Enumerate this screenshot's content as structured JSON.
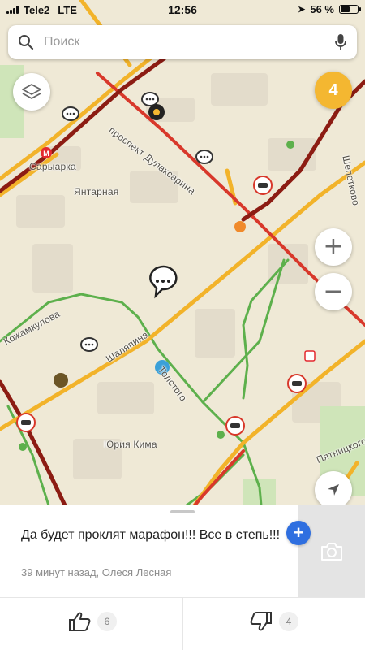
{
  "status_bar": {
    "carrier": "Tele2",
    "network": "LTE",
    "time": "12:56",
    "battery_text": "56 %",
    "battery_level": 0.56
  },
  "search": {
    "placeholder": "Поиск",
    "icon": "search-icon",
    "mic_icon": "microphone-icon"
  },
  "map": {
    "traffic_level": "4",
    "traffic_color": "#f4b731",
    "streets": {
      "prospekt": "проспект Дулаксаринa",
      "metro": "Сарыарка",
      "yantarnaya": "Янтарная",
      "kozhamkulova": "Кожамкулова",
      "shalyapina": "Шаляпина",
      "tolstogo": "Толстого",
      "yuriya_kima": "Юрия Кима",
      "shepetkova": "Шепетково",
      "pyatnitskogo": "Пятницкого"
    },
    "controls": {
      "zoom_in": "+",
      "zoom_out": "−"
    }
  },
  "post": {
    "text": "Да будет проклят марафон!!! Все в степь!!!",
    "time_ago": "39 минут назад, Олеся Лесная",
    "add_label": "+",
    "likes": "6",
    "dislikes": "4"
  },
  "colors": {
    "road_jam": "#8c1c13",
    "road_heavy": "#d8382b",
    "road_medium": "#f2b32a",
    "road_free": "#5db04c",
    "accent": "#2f6fe0"
  }
}
